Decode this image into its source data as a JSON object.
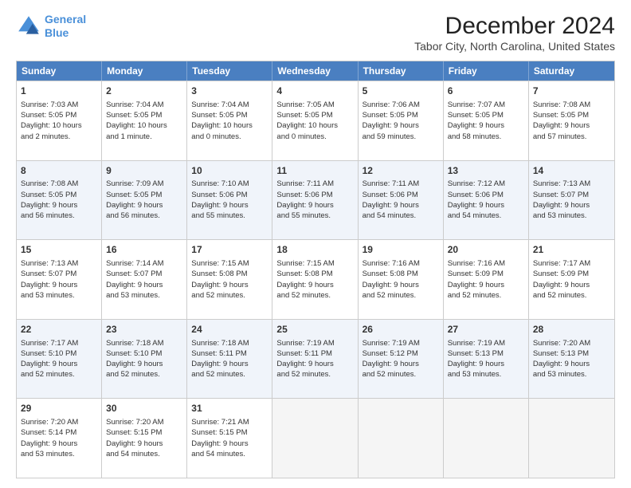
{
  "logo": {
    "line1": "General",
    "line2": "Blue"
  },
  "title": "December 2024",
  "subtitle": "Tabor City, North Carolina, United States",
  "header_days": [
    "Sunday",
    "Monday",
    "Tuesday",
    "Wednesday",
    "Thursday",
    "Friday",
    "Saturday"
  ],
  "weeks": [
    [
      {
        "num": "1",
        "lines": [
          "Sunrise: 7:03 AM",
          "Sunset: 5:05 PM",
          "Daylight: 10 hours",
          "and 2 minutes."
        ]
      },
      {
        "num": "2",
        "lines": [
          "Sunrise: 7:04 AM",
          "Sunset: 5:05 PM",
          "Daylight: 10 hours",
          "and 1 minute."
        ]
      },
      {
        "num": "3",
        "lines": [
          "Sunrise: 7:04 AM",
          "Sunset: 5:05 PM",
          "Daylight: 10 hours",
          "and 0 minutes."
        ]
      },
      {
        "num": "4",
        "lines": [
          "Sunrise: 7:05 AM",
          "Sunset: 5:05 PM",
          "Daylight: 10 hours",
          "and 0 minutes."
        ]
      },
      {
        "num": "5",
        "lines": [
          "Sunrise: 7:06 AM",
          "Sunset: 5:05 PM",
          "Daylight: 9 hours",
          "and 59 minutes."
        ]
      },
      {
        "num": "6",
        "lines": [
          "Sunrise: 7:07 AM",
          "Sunset: 5:05 PM",
          "Daylight: 9 hours",
          "and 58 minutes."
        ]
      },
      {
        "num": "7",
        "lines": [
          "Sunrise: 7:08 AM",
          "Sunset: 5:05 PM",
          "Daylight: 9 hours",
          "and 57 minutes."
        ]
      }
    ],
    [
      {
        "num": "8",
        "lines": [
          "Sunrise: 7:08 AM",
          "Sunset: 5:05 PM",
          "Daylight: 9 hours",
          "and 56 minutes."
        ]
      },
      {
        "num": "9",
        "lines": [
          "Sunrise: 7:09 AM",
          "Sunset: 5:05 PM",
          "Daylight: 9 hours",
          "and 56 minutes."
        ]
      },
      {
        "num": "10",
        "lines": [
          "Sunrise: 7:10 AM",
          "Sunset: 5:06 PM",
          "Daylight: 9 hours",
          "and 55 minutes."
        ]
      },
      {
        "num": "11",
        "lines": [
          "Sunrise: 7:11 AM",
          "Sunset: 5:06 PM",
          "Daylight: 9 hours",
          "and 55 minutes."
        ]
      },
      {
        "num": "12",
        "lines": [
          "Sunrise: 7:11 AM",
          "Sunset: 5:06 PM",
          "Daylight: 9 hours",
          "and 54 minutes."
        ]
      },
      {
        "num": "13",
        "lines": [
          "Sunrise: 7:12 AM",
          "Sunset: 5:06 PM",
          "Daylight: 9 hours",
          "and 54 minutes."
        ]
      },
      {
        "num": "14",
        "lines": [
          "Sunrise: 7:13 AM",
          "Sunset: 5:07 PM",
          "Daylight: 9 hours",
          "and 53 minutes."
        ]
      }
    ],
    [
      {
        "num": "15",
        "lines": [
          "Sunrise: 7:13 AM",
          "Sunset: 5:07 PM",
          "Daylight: 9 hours",
          "and 53 minutes."
        ]
      },
      {
        "num": "16",
        "lines": [
          "Sunrise: 7:14 AM",
          "Sunset: 5:07 PM",
          "Daylight: 9 hours",
          "and 53 minutes."
        ]
      },
      {
        "num": "17",
        "lines": [
          "Sunrise: 7:15 AM",
          "Sunset: 5:08 PM",
          "Daylight: 9 hours",
          "and 52 minutes."
        ]
      },
      {
        "num": "18",
        "lines": [
          "Sunrise: 7:15 AM",
          "Sunset: 5:08 PM",
          "Daylight: 9 hours",
          "and 52 minutes."
        ]
      },
      {
        "num": "19",
        "lines": [
          "Sunrise: 7:16 AM",
          "Sunset: 5:08 PM",
          "Daylight: 9 hours",
          "and 52 minutes."
        ]
      },
      {
        "num": "20",
        "lines": [
          "Sunrise: 7:16 AM",
          "Sunset: 5:09 PM",
          "Daylight: 9 hours",
          "and 52 minutes."
        ]
      },
      {
        "num": "21",
        "lines": [
          "Sunrise: 7:17 AM",
          "Sunset: 5:09 PM",
          "Daylight: 9 hours",
          "and 52 minutes."
        ]
      }
    ],
    [
      {
        "num": "22",
        "lines": [
          "Sunrise: 7:17 AM",
          "Sunset: 5:10 PM",
          "Daylight: 9 hours",
          "and 52 minutes."
        ]
      },
      {
        "num": "23",
        "lines": [
          "Sunrise: 7:18 AM",
          "Sunset: 5:10 PM",
          "Daylight: 9 hours",
          "and 52 minutes."
        ]
      },
      {
        "num": "24",
        "lines": [
          "Sunrise: 7:18 AM",
          "Sunset: 5:11 PM",
          "Daylight: 9 hours",
          "and 52 minutes."
        ]
      },
      {
        "num": "25",
        "lines": [
          "Sunrise: 7:19 AM",
          "Sunset: 5:11 PM",
          "Daylight: 9 hours",
          "and 52 minutes."
        ]
      },
      {
        "num": "26",
        "lines": [
          "Sunrise: 7:19 AM",
          "Sunset: 5:12 PM",
          "Daylight: 9 hours",
          "and 52 minutes."
        ]
      },
      {
        "num": "27",
        "lines": [
          "Sunrise: 7:19 AM",
          "Sunset: 5:13 PM",
          "Daylight: 9 hours",
          "and 53 minutes."
        ]
      },
      {
        "num": "28",
        "lines": [
          "Sunrise: 7:20 AM",
          "Sunset: 5:13 PM",
          "Daylight: 9 hours",
          "and 53 minutes."
        ]
      }
    ],
    [
      {
        "num": "29",
        "lines": [
          "Sunrise: 7:20 AM",
          "Sunset: 5:14 PM",
          "Daylight: 9 hours",
          "and 53 minutes."
        ]
      },
      {
        "num": "30",
        "lines": [
          "Sunrise: 7:20 AM",
          "Sunset: 5:15 PM",
          "Daylight: 9 hours",
          "and 54 minutes."
        ]
      },
      {
        "num": "31",
        "lines": [
          "Sunrise: 7:21 AM",
          "Sunset: 5:15 PM",
          "Daylight: 9 hours",
          "and 54 minutes."
        ]
      },
      null,
      null,
      null,
      null
    ]
  ]
}
